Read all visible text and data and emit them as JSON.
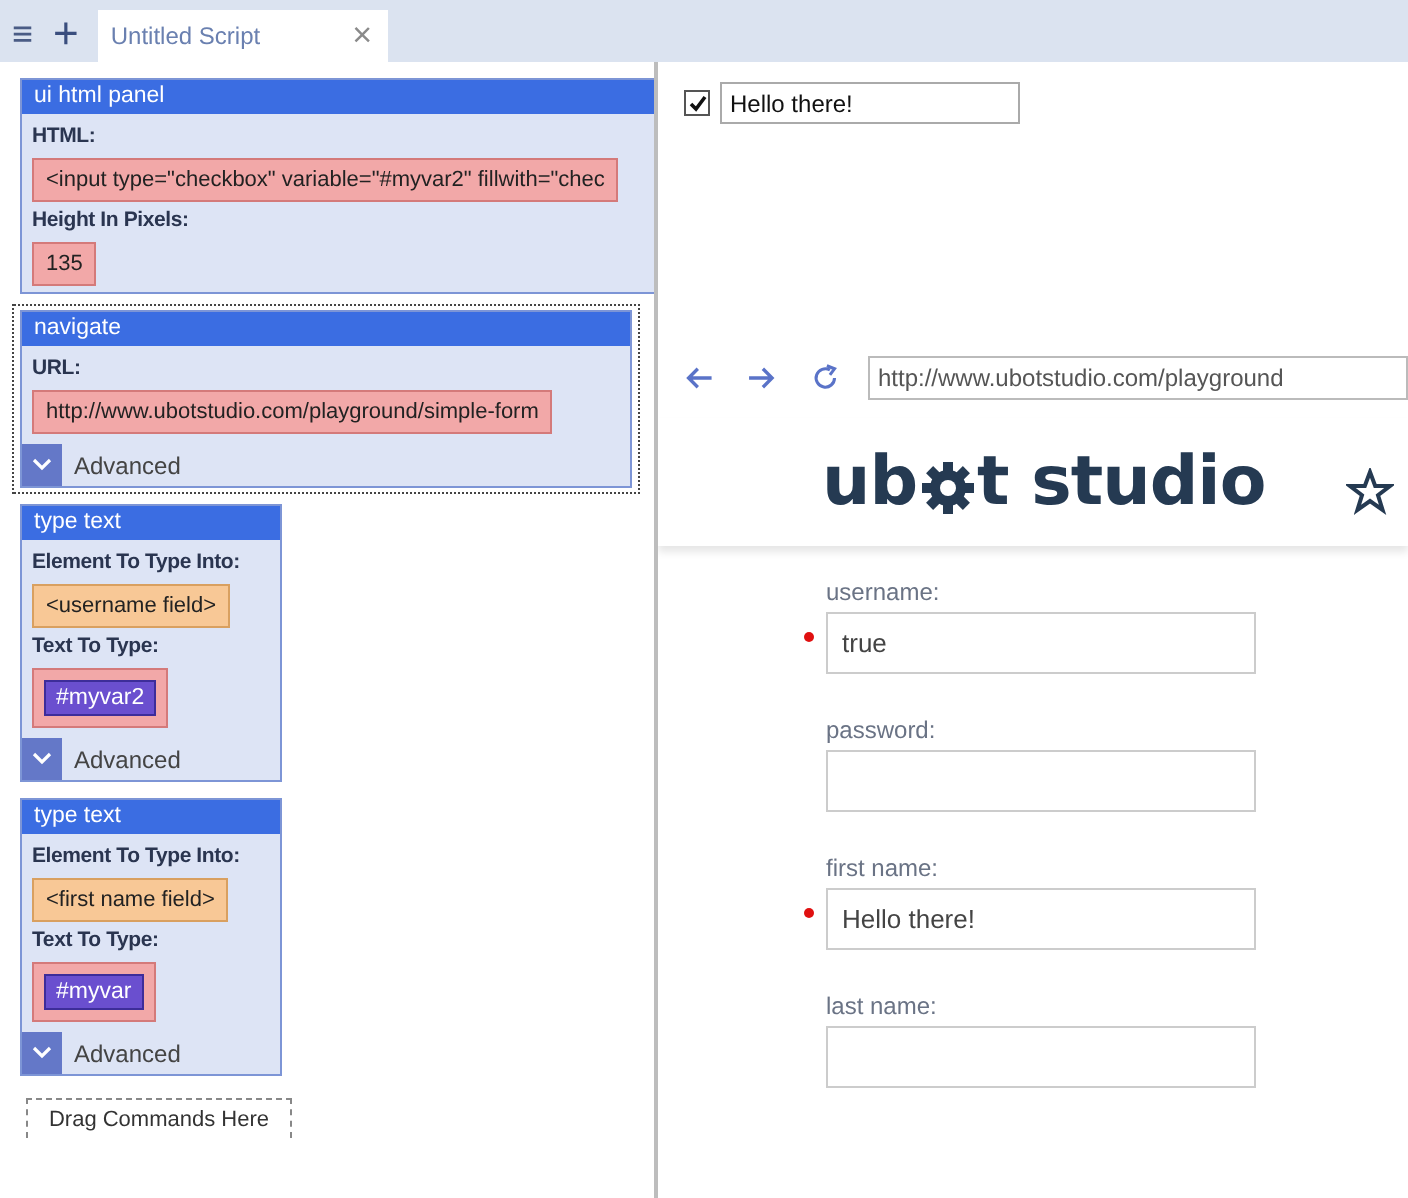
{
  "tab_bar": {
    "menu": "≡",
    "add": "+",
    "tabs": [
      {
        "label": "Untitled Script",
        "close": "×",
        "selected": true
      }
    ]
  },
  "commands": [
    {
      "title": "ui html panel",
      "selected": false,
      "fields": [
        {
          "label": "HTML:",
          "value": "<input type=\"checkbox\" variable=\"#myvar2\" fillwith=\"chec",
          "kind": "text"
        },
        {
          "label": "Height In Pixels:",
          "value": "135",
          "kind": "text"
        }
      ]
    },
    {
      "title": "navigate",
      "selected": true,
      "fields": [
        {
          "label": "URL:",
          "value": "http://www.ubotstudio.com/playground/simple-form",
          "kind": "text"
        }
      ],
      "advanced": "Advanced"
    },
    {
      "title": "type text",
      "selected": false,
      "fields": [
        {
          "label": "Element To Type Into:",
          "value": "<username field>",
          "kind": "element"
        },
        {
          "label": "Text To Type:",
          "value": "#myvar2",
          "kind": "variable"
        }
      ],
      "advanced": "Advanced"
    },
    {
      "title": "type text",
      "selected": false,
      "fields": [
        {
          "label": "Element To Type Into:",
          "value": "<first name field>",
          "kind": "element"
        },
        {
          "label": "Text To Type:",
          "value": "#myvar",
          "kind": "variable"
        }
      ],
      "advanced": "Advanced"
    }
  ],
  "drop_zone": "Drag Commands Here",
  "ui_panel": {
    "checked": true,
    "value": "Hello there!"
  },
  "browser": {
    "url": "http://www.ubotstudio.com/playground",
    "logo_before": "ub",
    "logo_after": "t studio",
    "form": [
      {
        "label": "username:",
        "value": "true",
        "marked": true
      },
      {
        "label": "password:",
        "marked": false
      },
      {
        "label": "first name:",
        "value": "Hello there!",
        "marked": true
      },
      {
        "label": "last name:",
        "marked": false
      }
    ]
  }
}
